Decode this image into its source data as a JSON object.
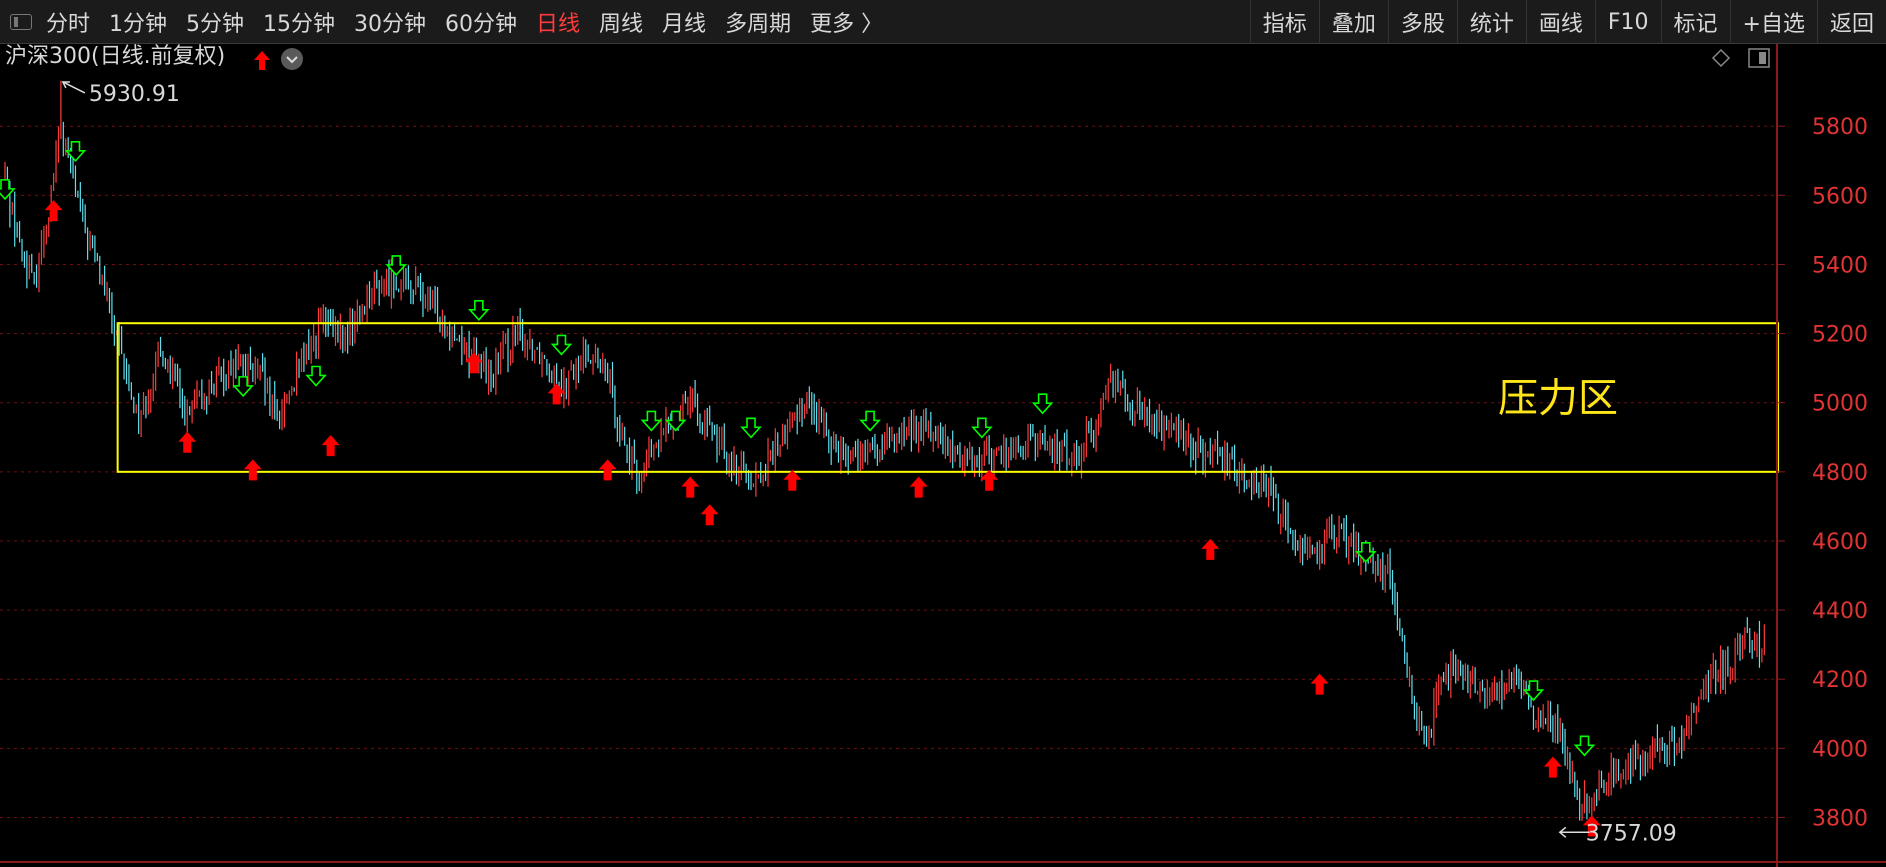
{
  "toolbar": {
    "periods": [
      {
        "label": "分时",
        "active": false
      },
      {
        "label": "1分钟",
        "active": false
      },
      {
        "label": "5分钟",
        "active": false
      },
      {
        "label": "15分钟",
        "active": false
      },
      {
        "label": "30分钟",
        "active": false
      },
      {
        "label": "60分钟",
        "active": false
      },
      {
        "label": "日线",
        "active": true
      },
      {
        "label": "周线",
        "active": false
      },
      {
        "label": "月线",
        "active": false
      },
      {
        "label": "多周期",
        "active": false
      },
      {
        "label": "更多 〉",
        "active": false
      }
    ],
    "buttons": [
      "指标",
      "叠加",
      "多股",
      "统计",
      "画线",
      "F10",
      "标记",
      "+自选",
      "返回"
    ]
  },
  "chart_title": "沪深300(日线.前复权)",
  "colors": {
    "up": "#ff3b3b",
    "down": "#5ee1f0",
    "buy_arrow": "#ff0000",
    "sell_arrow": "#00ff00",
    "zone": "#ffff00",
    "axis_text": "#e03434",
    "grid": "#6e1010"
  },
  "chart_data": {
    "type": "candlestick",
    "title": "沪深300(日线.前复权)",
    "ylim": [
      3700,
      5980
    ],
    "yticks": [
      3800,
      4000,
      4200,
      4400,
      4600,
      4800,
      5000,
      5200,
      5400,
      5600,
      5800
    ],
    "grid": true,
    "extremes": {
      "high": {
        "label": "5930.91",
        "value": 5930.91,
        "index": 23
      },
      "low": {
        "label": "3757.09",
        "value": 3757.09,
        "index": 653
      }
    },
    "zone": {
      "label": "压力区",
      "y_low": 4800,
      "y_high": 5230,
      "index_start": 48,
      "index_end": 728
    },
    "anchors": [
      [
        0,
        5650
      ],
      [
        6,
        5450
      ],
      [
        12,
        5340
      ],
      [
        18,
        5560
      ],
      [
        23,
        5800
      ],
      [
        32,
        5520
      ],
      [
        40,
        5350
      ],
      [
        48,
        5120
      ],
      [
        55,
        4950
      ],
      [
        65,
        5150
      ],
      [
        75,
        4950
      ],
      [
        85,
        5050
      ],
      [
        95,
        5120
      ],
      [
        105,
        5080
      ],
      [
        112,
        4950
      ],
      [
        120,
        5080
      ],
      [
        130,
        5230
      ],
      [
        140,
        5180
      ],
      [
        150,
        5320
      ],
      [
        160,
        5360
      ],
      [
        170,
        5320
      ],
      [
        180,
        5250
      ],
      [
        190,
        5150
      ],
      [
        200,
        5080
      ],
      [
        210,
        5200
      ],
      [
        220,
        5150
      ],
      [
        230,
        5050
      ],
      [
        240,
        5150
      ],
      [
        248,
        5080
      ],
      [
        254,
        4900
      ],
      [
        260,
        4780
      ],
      [
        270,
        4900
      ],
      [
        280,
        5020
      ],
      [
        290,
        4920
      ],
      [
        300,
        4820
      ],
      [
        310,
        4780
      ],
      [
        320,
        4900
      ],
      [
        330,
        5010
      ],
      [
        340,
        4890
      ],
      [
        350,
        4840
      ],
      [
        360,
        4860
      ],
      [
        370,
        4920
      ],
      [
        380,
        4930
      ],
      [
        390,
        4850
      ],
      [
        400,
        4840
      ],
      [
        410,
        4850
      ],
      [
        420,
        4880
      ],
      [
        430,
        4880
      ],
      [
        440,
        4840
      ],
      [
        448,
        4920
      ],
      [
        455,
        5080
      ],
      [
        462,
        5020
      ],
      [
        470,
        4950
      ],
      [
        480,
        4930
      ],
      [
        490,
        4860
      ],
      [
        500,
        4830
      ],
      [
        510,
        4790
      ],
      [
        520,
        4750
      ],
      [
        530,
        4600
      ],
      [
        540,
        4580
      ],
      [
        550,
        4620
      ],
      [
        560,
        4550
      ],
      [
        570,
        4500
      ],
      [
        575,
        4300
      ],
      [
        580,
        4100
      ],
      [
        585,
        4000
      ],
      [
        590,
        4200
      ],
      [
        600,
        4220
      ],
      [
        610,
        4150
      ],
      [
        620,
        4200
      ],
      [
        630,
        4100
      ],
      [
        640,
        4050
      ],
      [
        648,
        3850
      ],
      [
        653,
        3830
      ],
      [
        660,
        3930
      ],
      [
        670,
        3960
      ],
      [
        680,
        3990
      ],
      [
        690,
        4020
      ],
      [
        700,
        4200
      ],
      [
        710,
        4250
      ],
      [
        716,
        4330
      ],
      [
        722,
        4300
      ]
    ],
    "sell_signals": [
      {
        "index": 0,
        "value": 5610
      },
      {
        "index": 29,
        "value": 5720
      },
      {
        "index": 161,
        "value": 5390
      },
      {
        "index": 195,
        "value": 5260
      },
      {
        "index": 229,
        "value": 5160
      },
      {
        "index": 98,
        "value": 5040
      },
      {
        "index": 128,
        "value": 5070
      },
      {
        "index": 266,
        "value": 4940
      },
      {
        "index": 276,
        "value": 4940
      },
      {
        "index": 307,
        "value": 4920
      },
      {
        "index": 356,
        "value": 4940
      },
      {
        "index": 427,
        "value": 4990
      },
      {
        "index": 402,
        "value": 4920
      },
      {
        "index": 560,
        "value": 4560
      },
      {
        "index": 629,
        "value": 4160
      },
      {
        "index": 650,
        "value": 4000
      }
    ],
    "buy_signals": [
      {
        "index": 20,
        "value": 5560
      },
      {
        "index": 75,
        "value": 4890
      },
      {
        "index": 102,
        "value": 4810
      },
      {
        "index": 134,
        "value": 4880
      },
      {
        "index": 193,
        "value": 5120
      },
      {
        "index": 227,
        "value": 5030
      },
      {
        "index": 248,
        "value": 4810
      },
      {
        "index": 282,
        "value": 4760
      },
      {
        "index": 290,
        "value": 4680
      },
      {
        "index": 324,
        "value": 4780
      },
      {
        "index": 376,
        "value": 4760
      },
      {
        "index": 405,
        "value": 4780
      },
      {
        "index": 496,
        "value": 4580
      },
      {
        "index": 541,
        "value": 4190
      },
      {
        "index": 637,
        "value": 3950
      },
      {
        "index": 653,
        "value": 3780
      }
    ]
  }
}
